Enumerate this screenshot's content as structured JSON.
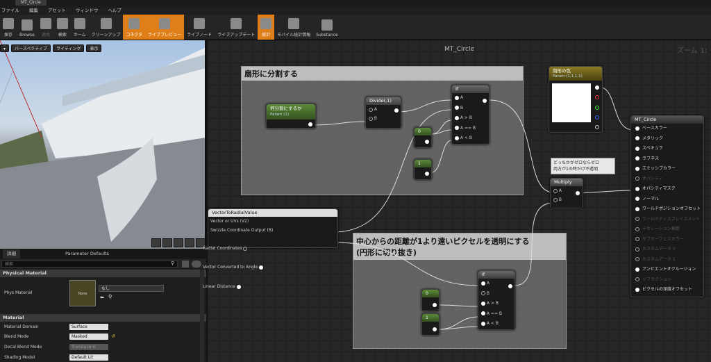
{
  "window": {
    "tab_title": "MT_Circle"
  },
  "menu": [
    "ファイル",
    "編集",
    "アセット",
    "ウィンドウ",
    "ヘルプ"
  ],
  "toolbar": [
    {
      "label": "保存",
      "state": "normal"
    },
    {
      "label": "Browse",
      "state": "normal"
    },
    {
      "label": "適用",
      "state": "disabled"
    },
    {
      "label": "検索",
      "state": "normal"
    },
    {
      "label": "ホーム",
      "state": "normal"
    },
    {
      "label": "クリーンアップ",
      "state": "normal"
    },
    {
      "label": "コネクタ",
      "state": "active"
    },
    {
      "label": "ライブプレビュー",
      "state": "active"
    },
    {
      "label": "ライブノード",
      "state": "normal"
    },
    {
      "label": "ライブアップデート",
      "state": "normal"
    },
    {
      "label": "統計",
      "state": "active"
    },
    {
      "label": "モバイル統計情報",
      "state": "normal"
    },
    {
      "label": "Substance",
      "state": "normal"
    }
  ],
  "viewport": {
    "perspective": "パースペクティブ",
    "lighting": "ライティング",
    "show": "表示"
  },
  "details": {
    "tab_details": "詳細",
    "tab_params": "Parameter Defaults",
    "search_placeholder": "検索",
    "physical_material_section": "Physical Material",
    "phys_material_label": "Phys Material",
    "phys_material_thumb": "None",
    "phys_material_value": "なし",
    "material_section": "Material",
    "props": [
      {
        "label": "Material Domain",
        "value": "Surface"
      },
      {
        "label": "Blend Mode",
        "value": "Masked"
      },
      {
        "label": "Decal Blend Mode",
        "value": "Translucent"
      },
      {
        "label": "Shading Model",
        "value": "Default Lit"
      }
    ]
  },
  "graph": {
    "title": "MT_Circle",
    "zoom": "ズーム 1:",
    "comment1": "扇形に分割する",
    "comment2_line1": "中心からの距離が1より遠いピクセルを透明にする",
    "comment2_line2": "(円形に切り抜き)",
    "param_node": {
      "title": "何分割にするか",
      "sub": "Param (1)"
    },
    "divide_node": {
      "title": "Divide(,1)",
      "a": "A",
      "b": "B"
    },
    "if1": {
      "title": "If",
      "pins": [
        "A",
        "B",
        "A > B",
        "A == B",
        "A < B"
      ]
    },
    "if2": {
      "title": "If",
      "pins": [
        "A",
        "B",
        "A > B",
        "A == B",
        "A < B"
      ]
    },
    "const_zero": "0",
    "const_one": "1",
    "color_node": {
      "title": "扇形の色",
      "sub": "Param (1,1,1,1)"
    },
    "multiply": {
      "title": "Multiply",
      "a": "A",
      "b": "B"
    },
    "tooltip_line1": "どっちかがゼロならゼロ",
    "tooltip_line2": "両方が1の時だけ不透明",
    "radial": {
      "title": "VectorToRadialValue",
      "in1": "Vector or UVs (V2)",
      "in2": "Swizzle Coordinate Output (B)",
      "out1": "Radial Coordinates",
      "out2": "Vector Converted to Angle",
      "out3": "Linear Distance"
    },
    "result": {
      "title": "MT_Circle",
      "pins": [
        {
          "label": "ベースカラー",
          "active": true
        },
        {
          "label": "メタリック",
          "active": true
        },
        {
          "label": "スペキュラ",
          "active": true
        },
        {
          "label": "ラフネス",
          "active": true
        },
        {
          "label": "エミッシブカラー",
          "active": true
        },
        {
          "label": "オパシティ",
          "active": false
        },
        {
          "label": "オパシティマスク",
          "active": true
        },
        {
          "label": "ノーマル",
          "active": true
        },
        {
          "label": "ワールドポジションオフセット",
          "active": true
        },
        {
          "label": "ワールドディスプレイスメント",
          "active": false
        },
        {
          "label": "テセレーション乗数",
          "active": false
        },
        {
          "label": "サブサーフェスカラー",
          "active": false
        },
        {
          "label": "カスタムデータ 0",
          "active": false
        },
        {
          "label": "カスタムデータ 1",
          "active": false
        },
        {
          "label": "アンビエントオクルージョン",
          "active": true
        },
        {
          "label": "リフラクション",
          "active": false
        },
        {
          "label": "ピクセルの深度オフセット",
          "active": true
        }
      ]
    }
  }
}
